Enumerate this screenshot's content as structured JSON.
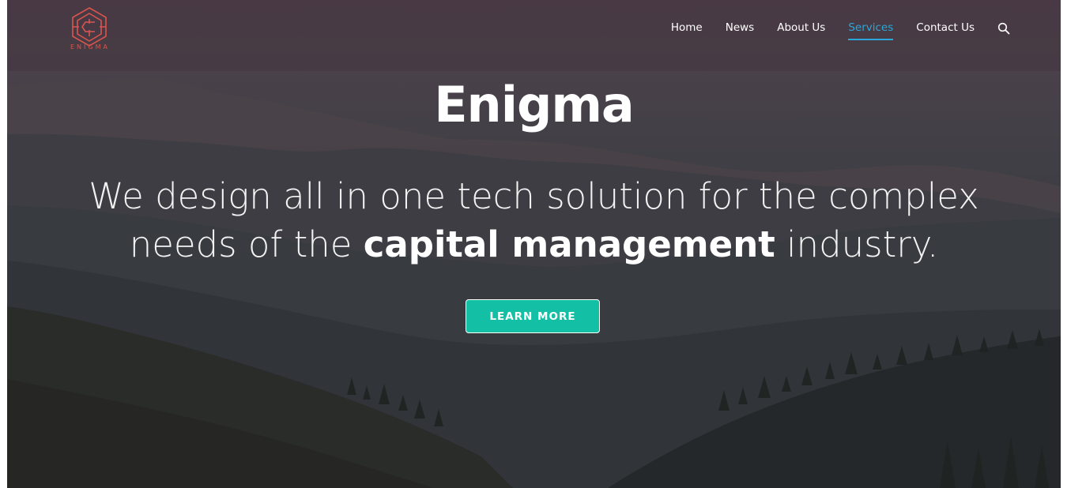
{
  "brand": {
    "logo_text": "ENIGMA",
    "title": "Enigma",
    "logo_color": "#d9554e"
  },
  "nav": {
    "items": [
      {
        "label": "Home"
      },
      {
        "label": "News"
      },
      {
        "label": "About Us"
      },
      {
        "label": "Services",
        "active": true
      },
      {
        "label": "Contact Us"
      }
    ],
    "search_icon": "search-icon",
    "active_color": "#2ba6d8"
  },
  "hero": {
    "tagline_line1": "We design all in one tech solution for the complex",
    "tagline_line2_pre": "needs of the ",
    "tagline_line2_bold": "capital management",
    "tagline_line2_post": " industry.",
    "cta_label": "LEARN MORE",
    "cta_color": "#14c0a5",
    "background": "misty mountain landscape"
  }
}
